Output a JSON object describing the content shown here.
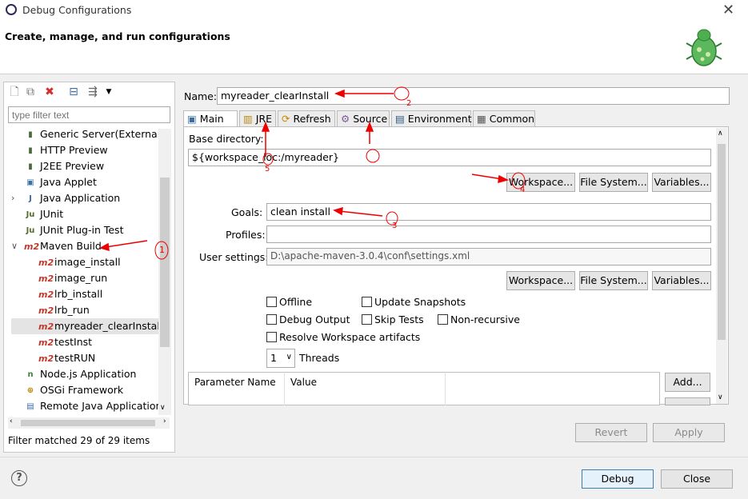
{
  "window": {
    "title": "Debug Configurations",
    "close_glyph": "✕"
  },
  "header": {
    "text": "Create, manage, and run configurations"
  },
  "left": {
    "filter_placeholder": "type filter text",
    "tree": [
      {
        "label": "Generic Server(External L",
        "icon": "server-icon"
      },
      {
        "label": "HTTP Preview",
        "icon": "server-icon"
      },
      {
        "label": "J2EE Preview",
        "icon": "server-icon"
      },
      {
        "label": "Java Applet",
        "icon": "applet-icon"
      },
      {
        "label": "Java Application",
        "icon": "java-app-icon"
      },
      {
        "label": "JUnit",
        "icon": "junit-icon"
      },
      {
        "label": "JUnit Plug-in Test",
        "icon": "junit-plugin-icon"
      },
      {
        "label": "Maven Build",
        "icon": "m2-icon"
      },
      {
        "label": "image_install",
        "icon": "m2-icon"
      },
      {
        "label": "image_run",
        "icon": "m2-icon"
      },
      {
        "label": "lrb_install",
        "icon": "m2-icon"
      },
      {
        "label": "lrb_run",
        "icon": "m2-icon"
      },
      {
        "label": "myreader_clearInstall",
        "icon": "m2-icon"
      },
      {
        "label": "testInst",
        "icon": "m2-icon"
      },
      {
        "label": "testRUN",
        "icon": "m2-icon"
      },
      {
        "label": "Node.js Application",
        "icon": "nodejs-icon"
      },
      {
        "label": "OSGi Framework",
        "icon": "osgi-icon"
      },
      {
        "label": "Remote Java Application",
        "icon": "remote-java-icon"
      }
    ],
    "m2": "m2",
    "status": "Filter matched 29 of 29 items"
  },
  "right": {
    "name_label": "Name:",
    "name_value": "myreader_clearInstall",
    "tabs": [
      "Main",
      "JRE",
      "Refresh",
      "Source",
      "Environment",
      "Common"
    ],
    "base_dir_label": "Base directory:",
    "base_dir_value": "${workspace_loc:/myreader}",
    "workspace_btn": "Workspace...",
    "filesystem_btn": "File System...",
    "variables_btn": "Variables...",
    "goals_label": "Goals:",
    "goals_value": "clean install",
    "profiles_label": "Profiles:",
    "profiles_value": "",
    "user_settings_label": "User settings:",
    "user_settings_value": "D:\\apache-maven-3.0.4\\conf\\settings.xml",
    "checks": {
      "offline": "Offline",
      "update_snapshots": "Update Snapshots",
      "debug_output": "Debug Output",
      "skip_tests": "Skip Tests",
      "non_recursive": "Non-recursive",
      "resolve_ws": "Resolve Workspace artifacts"
    },
    "threads_value": "1",
    "threads_label": "Threads",
    "table_headers": [
      "Parameter Name",
      "Value"
    ],
    "add_btn": "Add...",
    "revert_btn": "Revert",
    "apply_btn": "Apply"
  },
  "footer": {
    "debug_btn": "Debug",
    "close_btn": "Close",
    "help_glyph": "?"
  },
  "annotations": {
    "n1": "1",
    "n2": "2",
    "n3": "3",
    "n4": "4",
    "n5": "5"
  },
  "colors": {
    "annotation": "#e00000",
    "m2": "#c0392b"
  }
}
